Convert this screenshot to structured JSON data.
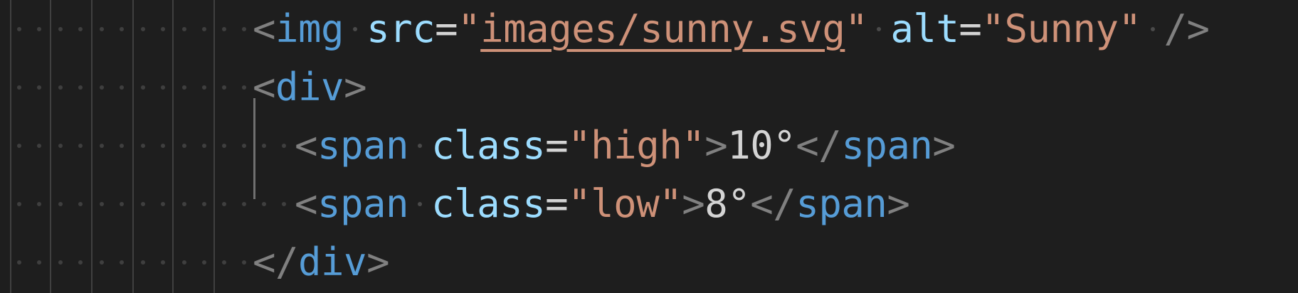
{
  "editor": {
    "colors": {
      "background": "#1e1e1e",
      "tag": "#569cd6",
      "attribute": "#9cdcfe",
      "string": "#ce9178",
      "punctuation": "#808080",
      "text": "#d4d4d4"
    },
    "lines": [
      {
        "open": "<",
        "tag": "img",
        "attr1": "src",
        "eq1": "=",
        "quote_open1": "\"",
        "value1": "images/sunny.svg",
        "quote_close1": "\"",
        "attr2": "alt",
        "eq2": "=",
        "quote_open2": "\"",
        "value2": "Sunny",
        "quote_close2": "\"",
        "close": "/>"
      },
      {
        "open": "<",
        "tag": "div",
        "close": ">"
      },
      {
        "open": "<",
        "tag": "span",
        "attr": "class",
        "eq": "=",
        "quote_open": "\"",
        "value": "high",
        "quote_close": "\"",
        "close": ">",
        "content": "10°",
        "end_open": "</",
        "end_tag": "span",
        "end_close": ">"
      },
      {
        "open": "<",
        "tag": "span",
        "attr": "class",
        "eq": "=",
        "quote_open": "\"",
        "value": "low",
        "quote_close": "\"",
        "close": ">",
        "content": "8°",
        "end_open": "</",
        "end_tag": "span",
        "end_close": ">"
      },
      {
        "open": "</",
        "tag": "div",
        "close": ">"
      }
    ]
  }
}
